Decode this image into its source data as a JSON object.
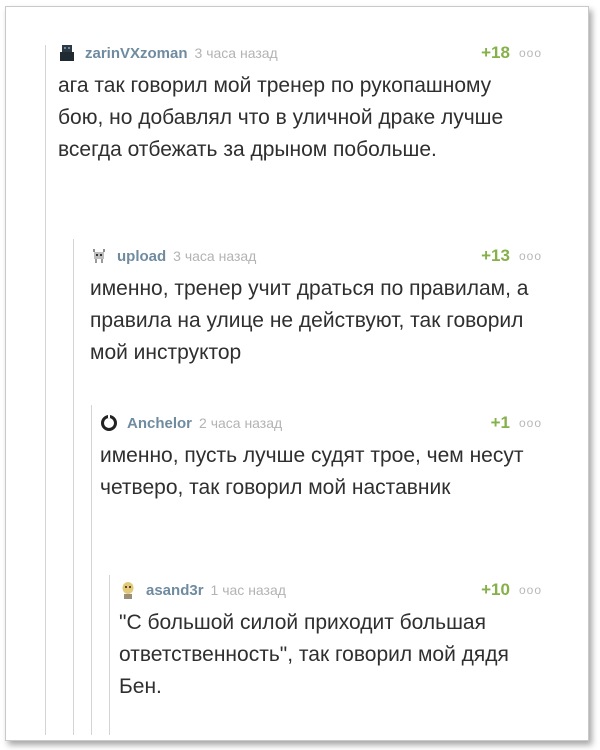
{
  "comments": [
    {
      "user": "zarinVXzoman",
      "time": "3 часа назад",
      "rating": "+18",
      "more": "ooo",
      "avatar_icon": "dark-figure-avatar-icon",
      "text": "ага так говорил мой тренер по рукопашному бою, но добавлял что в уличной драке лучше всегда отбежать за дрыном побольше."
    },
    {
      "user": "upload",
      "time": "3 часа назад",
      "rating": "+13",
      "more": "ooo",
      "avatar_icon": "pixel-creature-avatar-icon",
      "text": "именно, тренер учит драться по правилам, а правила на улице не действуют, так говорил мой инструктор"
    },
    {
      "user": "Anchelor",
      "time": "2 часа назад",
      "rating": "+1",
      "more": "ooo",
      "avatar_icon": "ring-avatar-icon",
      "text": "именно, пусть лучше судят трое, чем несут четверо, так говорил мой наставник"
    },
    {
      "user": "asand3r",
      "time": "1 час назад",
      "rating": "+10",
      "more": "ooo",
      "avatar_icon": "yellow-face-avatar-icon",
      "text": "\"С большой силой приходит большая ответственность\", так говорил мой дядя Бен."
    }
  ],
  "colors": {
    "username": "#6f8ba0",
    "rating": "#85b04a",
    "muted": "#b3b3b3",
    "text": "#2f2f2f",
    "thread_line": "#d4d4d4"
  }
}
